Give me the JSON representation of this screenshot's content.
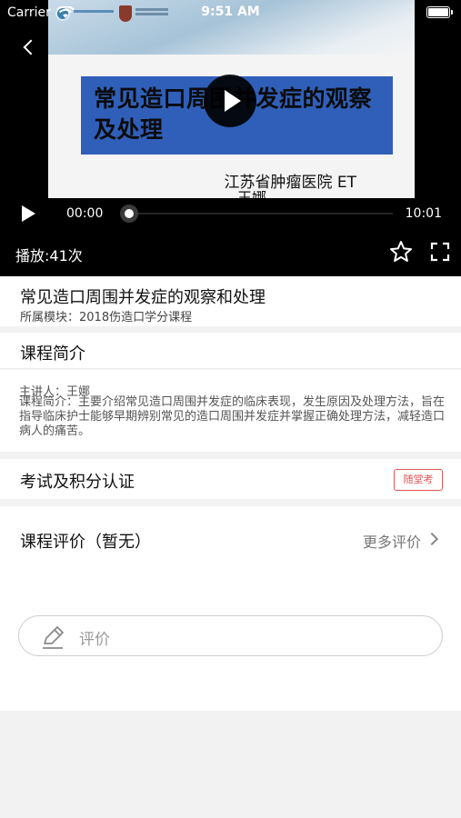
{
  "status_bar": {
    "carrier": "Carrier",
    "time": "9:51 AM"
  },
  "video": {
    "slide_title": "常见造口周围并发症的观察及处理",
    "slide_subtitle": "江苏省肿瘤医院 ET",
    "slide_subtitle2": "王娜",
    "current_time": "00:00",
    "total_time": "10:01",
    "progress": 0.0,
    "play_count": "播放:41次"
  },
  "course": {
    "title": "常见造口周围并发症的观察和处理",
    "module": "所属模块：2018伤造口学分课程"
  },
  "intro": {
    "heading": "课程简介",
    "lecturer": "主讲人：王娜",
    "text": "课程简介：主要介绍常见造口周围并发症的临床表现，发生原因及处理方法，旨在指导临床护士能够早期辨别常见的造口周围并发症并掌握正确处理方法，减轻造口病人的痛苦。"
  },
  "exam": {
    "heading": "考试及积分认证",
    "badge": "随堂考"
  },
  "review": {
    "heading": "课程评价（暂无）",
    "more_label": "更多评价",
    "input_placeholder": "评价"
  },
  "colors": {
    "accent_red": "#e05555",
    "slide_banner": "#2f5fb8"
  }
}
